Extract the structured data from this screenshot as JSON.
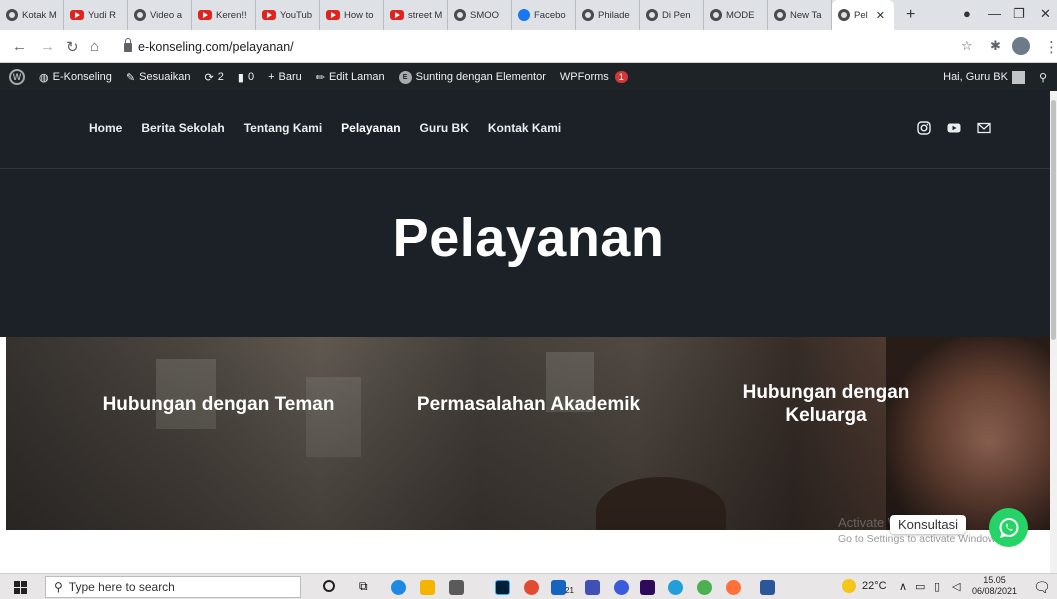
{
  "browser": {
    "tabs": [
      {
        "label": "Kotak M",
        "icon": "chrome-icon"
      },
      {
        "label": "Yudi R",
        "icon": "youtube-icon"
      },
      {
        "label": "Video a",
        "icon": "chrome-icon"
      },
      {
        "label": "Keren!!",
        "icon": "youtube-icon"
      },
      {
        "label": "YouTub",
        "icon": "youtube-icon"
      },
      {
        "label": "How to",
        "icon": "youtube-icon"
      },
      {
        "label": "street M",
        "icon": "youtube-icon"
      },
      {
        "label": "SMOO",
        "icon": "chrome-icon"
      },
      {
        "label": "Facebo",
        "icon": "facebook-icon"
      },
      {
        "label": "Philade",
        "icon": "chrome-icon"
      },
      {
        "label": "Di Pen",
        "icon": "chrome-icon"
      },
      {
        "label": "MODE",
        "icon": "chrome-icon"
      },
      {
        "label": "New Ta",
        "icon": "chrome-icon"
      },
      {
        "label": "Pel",
        "icon": "chrome-icon",
        "active": true
      }
    ],
    "new_tab": "+",
    "url": "e-konseling.com/pelayanan/"
  },
  "wp_admin_bar": {
    "site_name": "E-Konseling",
    "customize": "Sesuaikan",
    "updates_count": "2",
    "comments_count": "0",
    "new_label": "Baru",
    "edit_page": "Edit Laman",
    "elementor": "Sunting dengan Elementor",
    "wpforms": "WPForms",
    "wpforms_badge": "1",
    "greeting": "Hai, Guru BK"
  },
  "nav": {
    "items": [
      "Home",
      "Berita Sekolah",
      "Tentang Kami",
      "Pelayanan",
      "Guru BK",
      "Kontak Kami"
    ]
  },
  "hero": {
    "title": "Pelayanan"
  },
  "services": {
    "items": [
      {
        "title": "Hubungan dengan Teman"
      },
      {
        "title": "Permasalahan Akademik"
      },
      {
        "title": "Hubungan dengan Keluarga"
      }
    ]
  },
  "whatsapp": {
    "label": "Konsultasi"
  },
  "watermark": {
    "line1": "Activate Windows",
    "line2": "Go to Settings to activate Windows."
  },
  "taskbar": {
    "search_placeholder": "Type here to search",
    "weather": "22°C",
    "time": "15.05",
    "date": "06/08/2021",
    "notification_badge": "21"
  }
}
